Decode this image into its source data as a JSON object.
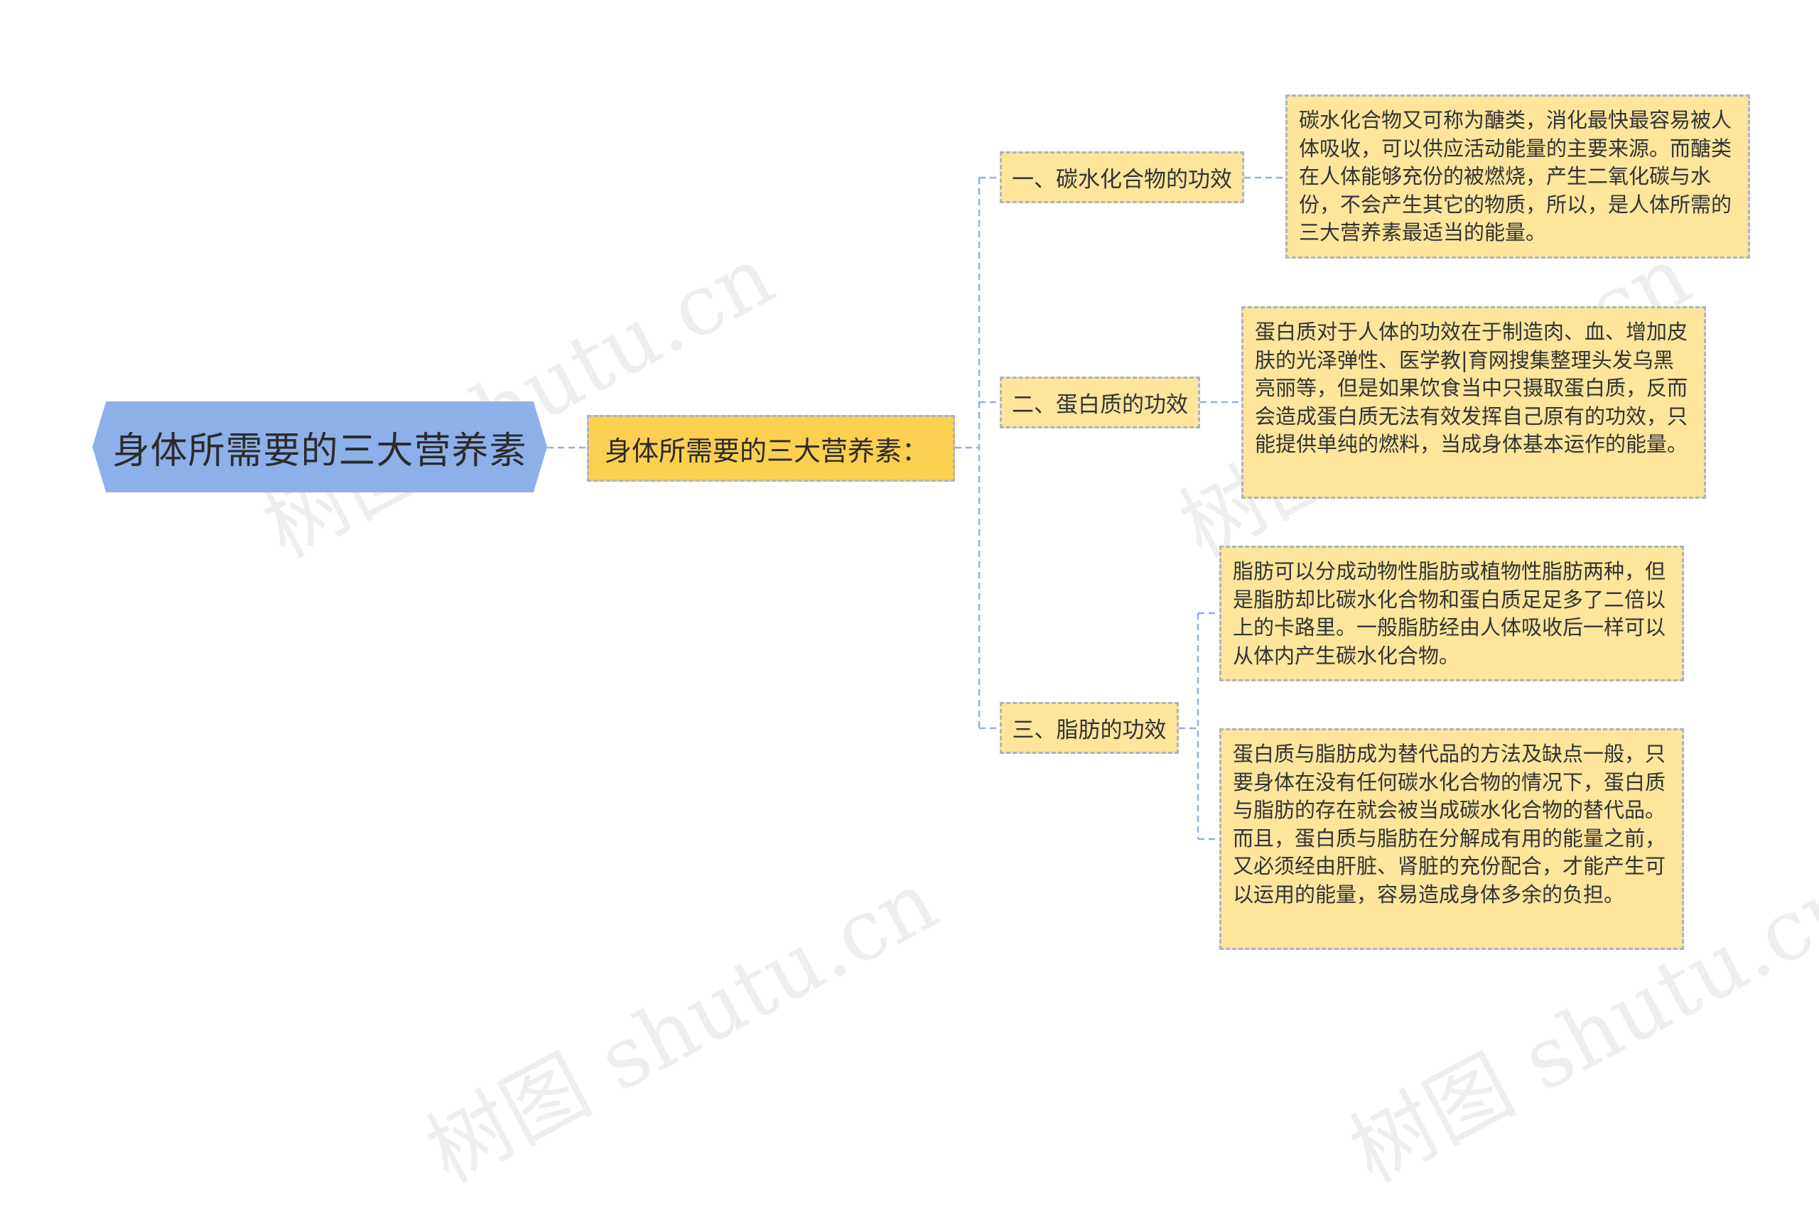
{
  "root": {
    "label": "身体所需要的三大营养素"
  },
  "sub": {
    "label": "身体所需要的三大营养素："
  },
  "topics": [
    {
      "label": "一、碳水化合物的功效",
      "details": [
        "碳水化合物又可称为醣类，消化最快最容易被人体吸收，可以供应活动能量的主要来源。而醣类在人体能够充份的被燃烧，产生二氧化碳与水份，不会产生其它的物质，所以，是人体所需的三大营养素最适当的能量。"
      ]
    },
    {
      "label": "二、蛋白质的功效",
      "details": [
        "蛋白质对于人体的功效在于制造肉、血、增加皮肤的光泽弹性、医学教|育网搜集整理头发乌黑亮丽等，但是如果饮食当中只摄取蛋白质，反而会造成蛋白质无法有效发挥自己原有的功效，只能提供单纯的燃料，当成身体基本运作的能量。"
      ]
    },
    {
      "label": "三、脂肪的功效",
      "details": [
        "脂肪可以分成动物性脂肪或植物性脂肪两种，但是脂肪却比碳水化合物和蛋白质足足多了二倍以上的卡路里。一般脂肪经由人体吸收后一样可以从体内产生碳水化合物。",
        "蛋白质与脂肪成为替代品的方法及缺点一般，只要身体在没有任何碳水化合物的情况下，蛋白质与脂肪的存在就会被当成碳水化合物的替代品。而且，蛋白质与脂肪在分解成有用的能量之前，又必须经由肝脏、肾脏的充份配合，才能产生可以运用的能量，容易造成身体多余的负担。"
      ]
    }
  ],
  "watermark": "树图 shutu.cn",
  "colors": {
    "root_fill": "#8db0e9",
    "sub_fill": "#fbd050",
    "node_fill": "#fde59b",
    "border": "#aab4c7",
    "connector": "#8fb0e6"
  }
}
